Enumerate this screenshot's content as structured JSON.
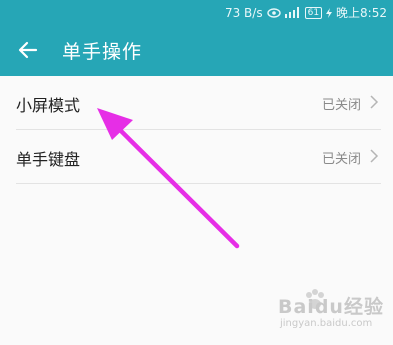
{
  "status_bar": {
    "speed": "73 B/s",
    "battery": "61",
    "time": "晚上8:52"
  },
  "header": {
    "title": "单手操作",
    "back_icon": "arrow-left-icon"
  },
  "settings": [
    {
      "label": "小屏模式",
      "value": "已关闭"
    },
    {
      "label": "单手键盘",
      "value": "已关闭"
    }
  ],
  "annotation": {
    "color": "#e62ee6"
  },
  "watermark": {
    "brand": "Baidu经验",
    "url": "jingyan.baidu.com"
  }
}
